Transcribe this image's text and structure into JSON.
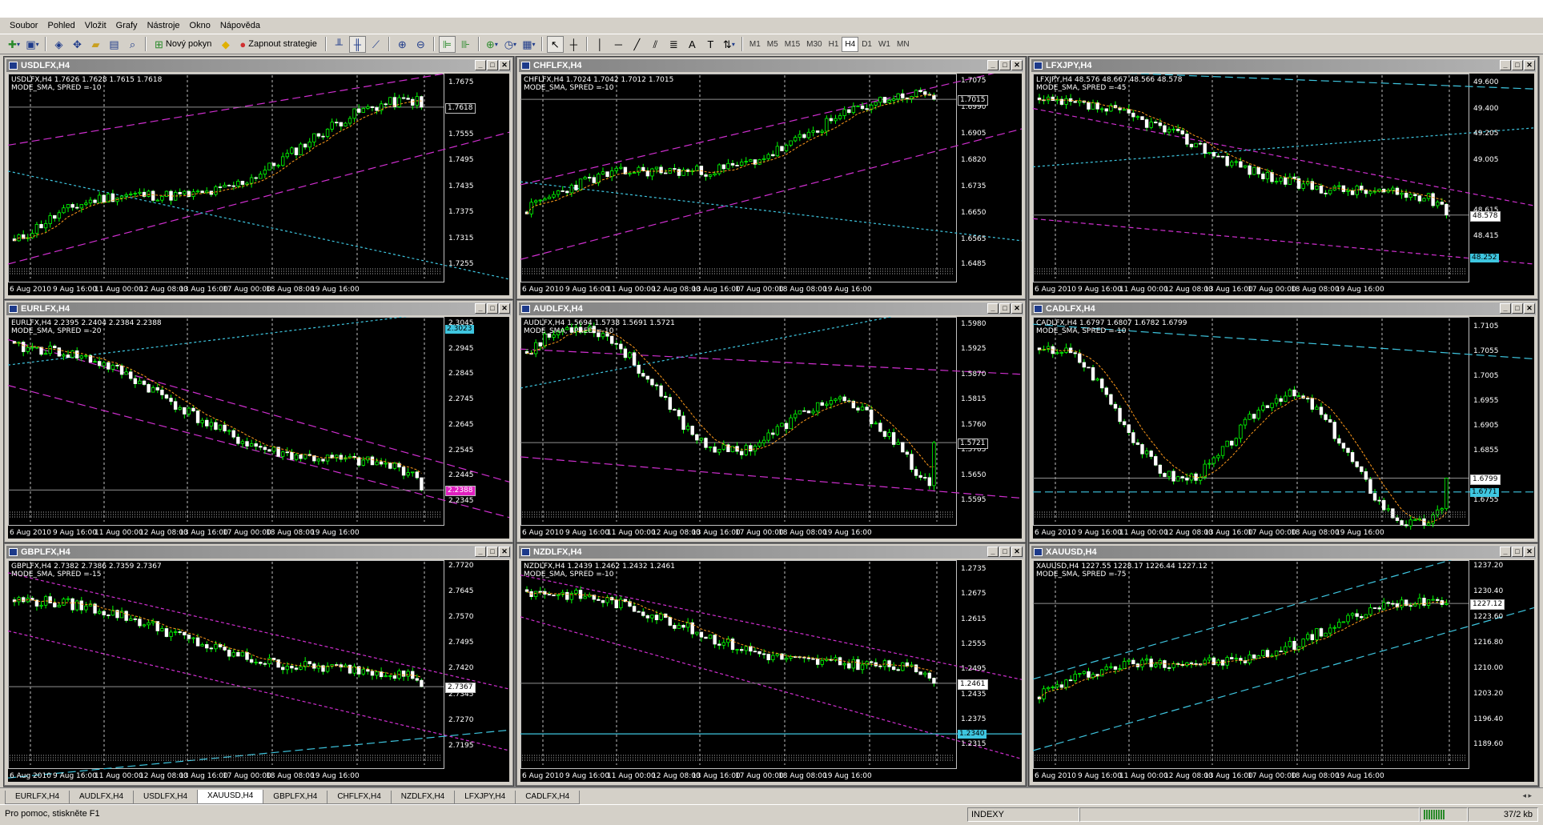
{
  "menu": [
    "Soubor",
    "Pohled",
    "Vložit",
    "Grafy",
    "Nástroje",
    "Okno",
    "Nápověda"
  ],
  "toolbar": {
    "new_order_label": "Nový pokyn",
    "strategy_label": "Zapnout strategie",
    "timeframes": [
      "M1",
      "M5",
      "M15",
      "M30",
      "H1",
      "H4",
      "D1",
      "W1",
      "MN"
    ],
    "active_timeframe": "H4"
  },
  "dates": [
    "6 Aug 2010",
    "9 Aug 16:00",
    "11 Aug 00:00",
    "12 Aug 08:00",
    "13 Aug 16:00",
    "17 Aug 00:00",
    "18 Aug 08:00",
    "19 Aug 16:00"
  ],
  "sub_label": "MODE_SMA, SPRED =-",
  "charts": [
    {
      "title": "USDLFX,H4",
      "info": "USDLFX,H4  1.7626 1.7628 1.7615 1.7618",
      "spread": "MODE_SMA, SPRED =-10",
      "ticks": [
        "1.7675",
        "1.7618",
        "1.7555",
        "1.7495",
        "1.7435",
        "1.7375",
        "1.7315",
        "1.7255"
      ],
      "current": "1.7618",
      "current_color": "#ffffff",
      "current_bg": "#000000",
      "shape": "up",
      "start": 1.7305,
      "end": 1.7618,
      "ymin": 1.7255,
      "ymax": 1.769,
      "seed": 11,
      "lines": [
        {
          "color": "#d02fd0",
          "dash": "10 5",
          "y1": 1.753,
          "y2": 1.772
        },
        {
          "color": "#d02fd0",
          "dash": "10 5",
          "y1": 1.7255,
          "y2": 1.756
        },
        {
          "color": "#3ec6e0",
          "dash": "3 3",
          "y1": 1.747,
          "y2": 1.722
        }
      ]
    },
    {
      "title": "CHFLFX,H4",
      "info": "CHFLFX,H4  1.7024 1.7042 1.7012 1.7015",
      "spread": "MODE_SMA, SPRED =-10",
      "ticks": [
        "1.7075",
        "1.7015",
        "1.6990",
        "1.6905",
        "1.6820",
        "1.6735",
        "1.6650",
        "1.6565",
        "1.6485"
      ],
      "current": "1.7015",
      "current_color": "#ffffff",
      "current_bg": "#000000",
      "shape": "up",
      "start": 1.666,
      "end": 1.7015,
      "ymin": 1.6485,
      "ymax": 1.709,
      "seed": 23,
      "lines": [
        {
          "color": "#d02fd0",
          "dash": "10 5",
          "y1": 1.674,
          "y2": 1.712
        },
        {
          "color": "#d02fd0",
          "dash": "10 5",
          "y1": 1.65,
          "y2": 1.692
        },
        {
          "color": "#3ec6e0",
          "dash": "3 3",
          "y1": 1.675,
          "y2": 1.656
        }
      ]
    },
    {
      "title": "LFXJPY,H4",
      "info": "LFXJPY,H4  48.576 48.667 48.566 48.578",
      "spread": "MODE_SMA, SPRED =-45",
      "ticks": [
        "49.600",
        "49.400",
        "49.205",
        "49.005",
        "48.615",
        "48.578",
        "48.415",
        "48.252"
      ],
      "current": "48.578",
      "current_color": "#000000",
      "current_bg": "#ffffff",
      "extra_tag": "48.252",
      "shape": "down",
      "start": 49.45,
      "end": 48.578,
      "ymin": 48.2,
      "ymax": 49.65,
      "seed": 37,
      "lines": [
        {
          "color": "#d02fd0",
          "dash": "6 4",
          "y1": 49.4,
          "y2": 48.65
        },
        {
          "color": "#d02fd0",
          "dash": "6 4",
          "y1": 48.55,
          "y2": 48.2
        },
        {
          "color": "#3ec6e0",
          "dash": "3 3",
          "y1": 48.95,
          "y2": 49.25
        },
        {
          "color": "#3ec6e0",
          "dash": "10 5",
          "y1": 49.7,
          "y2": 49.55
        }
      ]
    },
    {
      "title": "EURLFX,H4",
      "info": "EURLFX,H4  2.2395 2.2404 2.2384 2.2388",
      "spread": "MODE_SMA, SPRED =-20",
      "ticks": [
        "2.3045",
        "2.3023",
        "2.2945",
        "2.2845",
        "2.2745",
        "2.2645",
        "2.2545",
        "2.2445",
        "2.2388",
        "2.2345"
      ],
      "current": "2.2388",
      "current_color": "#ffffff",
      "current_bg": "#e020c0",
      "extra_tag": "2.3023",
      "shape": "down",
      "start": 2.295,
      "end": 2.2388,
      "ymin": 2.232,
      "ymax": 2.306,
      "seed": 41,
      "lines": [
        {
          "color": "#d02fd0",
          "dash": "10 5",
          "y1": 2.298,
          "y2": 2.242
        },
        {
          "color": "#d02fd0",
          "dash": "10 5",
          "y1": 2.28,
          "y2": 2.228
        },
        {
          "color": "#3ec6e0",
          "dash": "3 3",
          "y1": 2.288,
          "y2": 2.312
        }
      ]
    },
    {
      "title": "AUDLFX,H4",
      "info": "AUDLFX,H4  1.5694 1.5738 1.5691 1.5721",
      "spread": "MODE_SMA, SPRED =-10",
      "ticks": [
        "1.5980",
        "1.5925",
        "1.5870",
        "1.5815",
        "1.5760",
        "1.5721",
        "1.5705",
        "1.5650",
        "1.5595"
      ],
      "current": "1.5721",
      "current_color": "#ffffff",
      "current_bg": "#000000",
      "shape": "wave",
      "start": 1.592,
      "end": 1.5721,
      "ymin": 1.558,
      "ymax": 1.599,
      "seed": 53,
      "lines": [
        {
          "color": "#d02fd0",
          "dash": "10 5",
          "y1": 1.5925,
          "y2": 1.587
        },
        {
          "color": "#d02fd0",
          "dash": "10 5",
          "y1": 1.569,
          "y2": 1.56
        },
        {
          "color": "#3ec6e0",
          "dash": "3 3",
          "y1": 1.584,
          "y2": 1.605
        }
      ]
    },
    {
      "title": "CADLFX,H4",
      "info": "CADLFX,H4  1.6797 1.6807 1.6782 1.6799",
      "spread": "MODE_SMA, SPRED =-10",
      "ticks": [
        "1.7105",
        "1.7055",
        "1.7005",
        "1.6955",
        "1.6905",
        "1.6855",
        "1.6799",
        "1.6771",
        "1.6755"
      ],
      "current": "1.6799",
      "current_color": "#000000",
      "current_bg": "#ffffff",
      "extra_tag": "1.6771",
      "shape": "wave2",
      "start": 1.696,
      "end": 1.6799,
      "ymin": 1.674,
      "ymax": 1.712,
      "seed": 67,
      "lines": [
        {
          "color": "#3ec6e0",
          "dash": "10 5",
          "y1": 1.711,
          "y2": 1.704
        },
        {
          "color": "#3ec6e0",
          "dash": "10 5",
          "y1": 1.6771,
          "y2": 1.6771
        }
      ]
    },
    {
      "title": "GBPLFX,H4",
      "info": "GBPLFX,H4  2.7382 2.7386 2.7359 2.7367",
      "spread": "MODE_SMA, SPRED =-15",
      "ticks": [
        "2.7720",
        "2.7645",
        "2.7570",
        "2.7495",
        "2.7420",
        "2.7367",
        "2.7345",
        "2.7270",
        "2.7195"
      ],
      "current": "2.7367",
      "current_color": "#000000",
      "current_bg": "#ffffff",
      "shape": "down",
      "start": 2.762,
      "end": 2.7367,
      "ymin": 2.718,
      "ymax": 2.773,
      "seed": 79,
      "lines": [
        {
          "color": "#d02fd0",
          "dash": "4 3",
          "y1": 2.77,
          "y2": 2.736
        },
        {
          "color": "#d02fd0",
          "dash": "4 3",
          "y1": 2.753,
          "y2": 2.718
        },
        {
          "color": "#3ec6e0",
          "dash": "10 5",
          "y1": 2.71,
          "y2": 2.724
        }
      ]
    },
    {
      "title": "NZDLFX,H4",
      "info": "NZDLFX,H4  1.2439 1.2462 1.2432 1.2461",
      "spread": "MODE_SMA, SPRED =-10",
      "ticks": [
        "1.2735",
        "1.2675",
        "1.2615",
        "1.2555",
        "1.2495",
        "1.2461",
        "1.2435",
        "1.2375",
        "1.2340",
        "1.2315"
      ],
      "current": "1.2461",
      "current_color": "#000000",
      "current_bg": "#ffffff",
      "extra_tag": "1.2340",
      "shape": "down",
      "start": 1.268,
      "end": 1.2461,
      "ymin": 1.23,
      "ymax": 1.275,
      "seed": 83,
      "lines": [
        {
          "color": "#d02fd0",
          "dash": "4 3",
          "y1": 1.272,
          "y2": 1.247
        },
        {
          "color": "#d02fd0",
          "dash": "4 3",
          "y1": 1.262,
          "y2": 1.228
        },
        {
          "color": "#3ec6e0",
          "dash": "",
          "y1": 1.234,
          "y2": 1.234
        }
      ]
    },
    {
      "title": "XAUUSD,H4",
      "info": "XAUUSD,H4  1227.55 1228.17 1226.44 1227.12",
      "spread": "MODE_SMA, SPRED =-75",
      "ticks": [
        "1237.20",
        "1230.40",
        "1227.12",
        "1223.60",
        "1216.80",
        "1210.00",
        "1203.20",
        "1196.40",
        "1189.60"
      ],
      "current": "1227.12",
      "current_color": "#000000",
      "current_bg": "#ffffff",
      "shape": "up",
      "start": 1203.0,
      "end": 1227.12,
      "ymin": 1188.0,
      "ymax": 1238.0,
      "seed": 97,
      "lines": [
        {
          "color": "#3ec6e0",
          "dash": "10 5",
          "y1": 1207.0,
          "y2": 1245.0
        },
        {
          "color": "#3ec6e0",
          "dash": "10 5",
          "y1": 1188.0,
          "y2": 1226.0
        }
      ]
    }
  ],
  "tabs": [
    "EURLFX,H4",
    "AUDLFX,H4",
    "USDLFX,H4",
    "XAUUSD,H4",
    "GBPLFX,H4",
    "CHFLFX,H4",
    "NZDLFX,H4",
    "LFXJPY,H4",
    "CADLFX,H4"
  ],
  "active_tab": "XAUUSD,H4",
  "status": {
    "help": "Pro pomoc, stiskněte F1",
    "profile": "INDEXY",
    "traffic": "37/2 kb"
  }
}
